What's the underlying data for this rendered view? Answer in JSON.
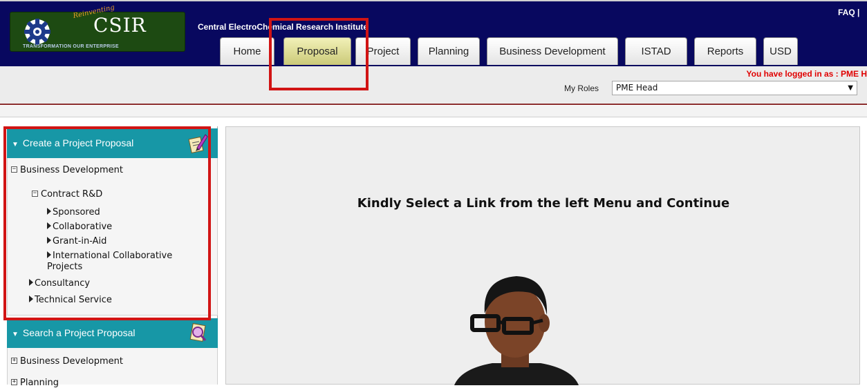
{
  "header": {
    "logo": {
      "tagline": "TRANSFORMATION OUR ENTERPRISE",
      "overlay_text": "Reinventing",
      "brand": "CSIR"
    },
    "institute_name": "Central ElectroChemical Research Institute",
    "faq_label": "FAQ |"
  },
  "tabs": [
    {
      "label": "Home",
      "active": false
    },
    {
      "label": "Proposal",
      "active": true
    },
    {
      "label": "Project",
      "active": false
    },
    {
      "label": "Planning",
      "active": false
    },
    {
      "label": "Business Development",
      "active": false
    },
    {
      "label": "ISTAD",
      "active": false
    },
    {
      "label": "Reports",
      "active": false
    },
    {
      "label": "USD",
      "active": false
    }
  ],
  "subbar": {
    "login_message": "You have logged in as : PME H",
    "roles_label": "My Roles",
    "roles_value": "PME Head"
  },
  "sidebar": {
    "create_panel": {
      "title": "Create a Project Proposal",
      "icon": "edit-pencil-icon",
      "items": [
        {
          "label": "Business Development",
          "marker": "minus"
        },
        {
          "label": "Contract R&D",
          "marker": "minus"
        },
        {
          "label": "Sponsored",
          "marker": "arrow"
        },
        {
          "label": "Collaborative",
          "marker": "arrow"
        },
        {
          "label": "Grant-in-Aid",
          "marker": "arrow"
        },
        {
          "label": "International Collaborative",
          "marker": "arrow"
        },
        {
          "label": "Projects",
          "marker": "none"
        },
        {
          "label": "Consultancy",
          "marker": "arrow"
        },
        {
          "label": "Technical Service",
          "marker": "arrow"
        }
      ]
    },
    "search_panel": {
      "title": "Search a Project Proposal",
      "icon": "search-magnifier-icon",
      "items": [
        {
          "label": "Business Development",
          "marker": "plus"
        },
        {
          "label": "Planning",
          "marker": "plus"
        }
      ]
    }
  },
  "main": {
    "message": "Kindly Select a Link from the left Menu and Continue",
    "illustration": "person-avatar-icon"
  },
  "colors": {
    "header_bg": "#08085f",
    "panel_head": "#1797a6",
    "active_tab": "#e6e49a",
    "highlight": "#d11414",
    "login_text": "#e00000"
  }
}
